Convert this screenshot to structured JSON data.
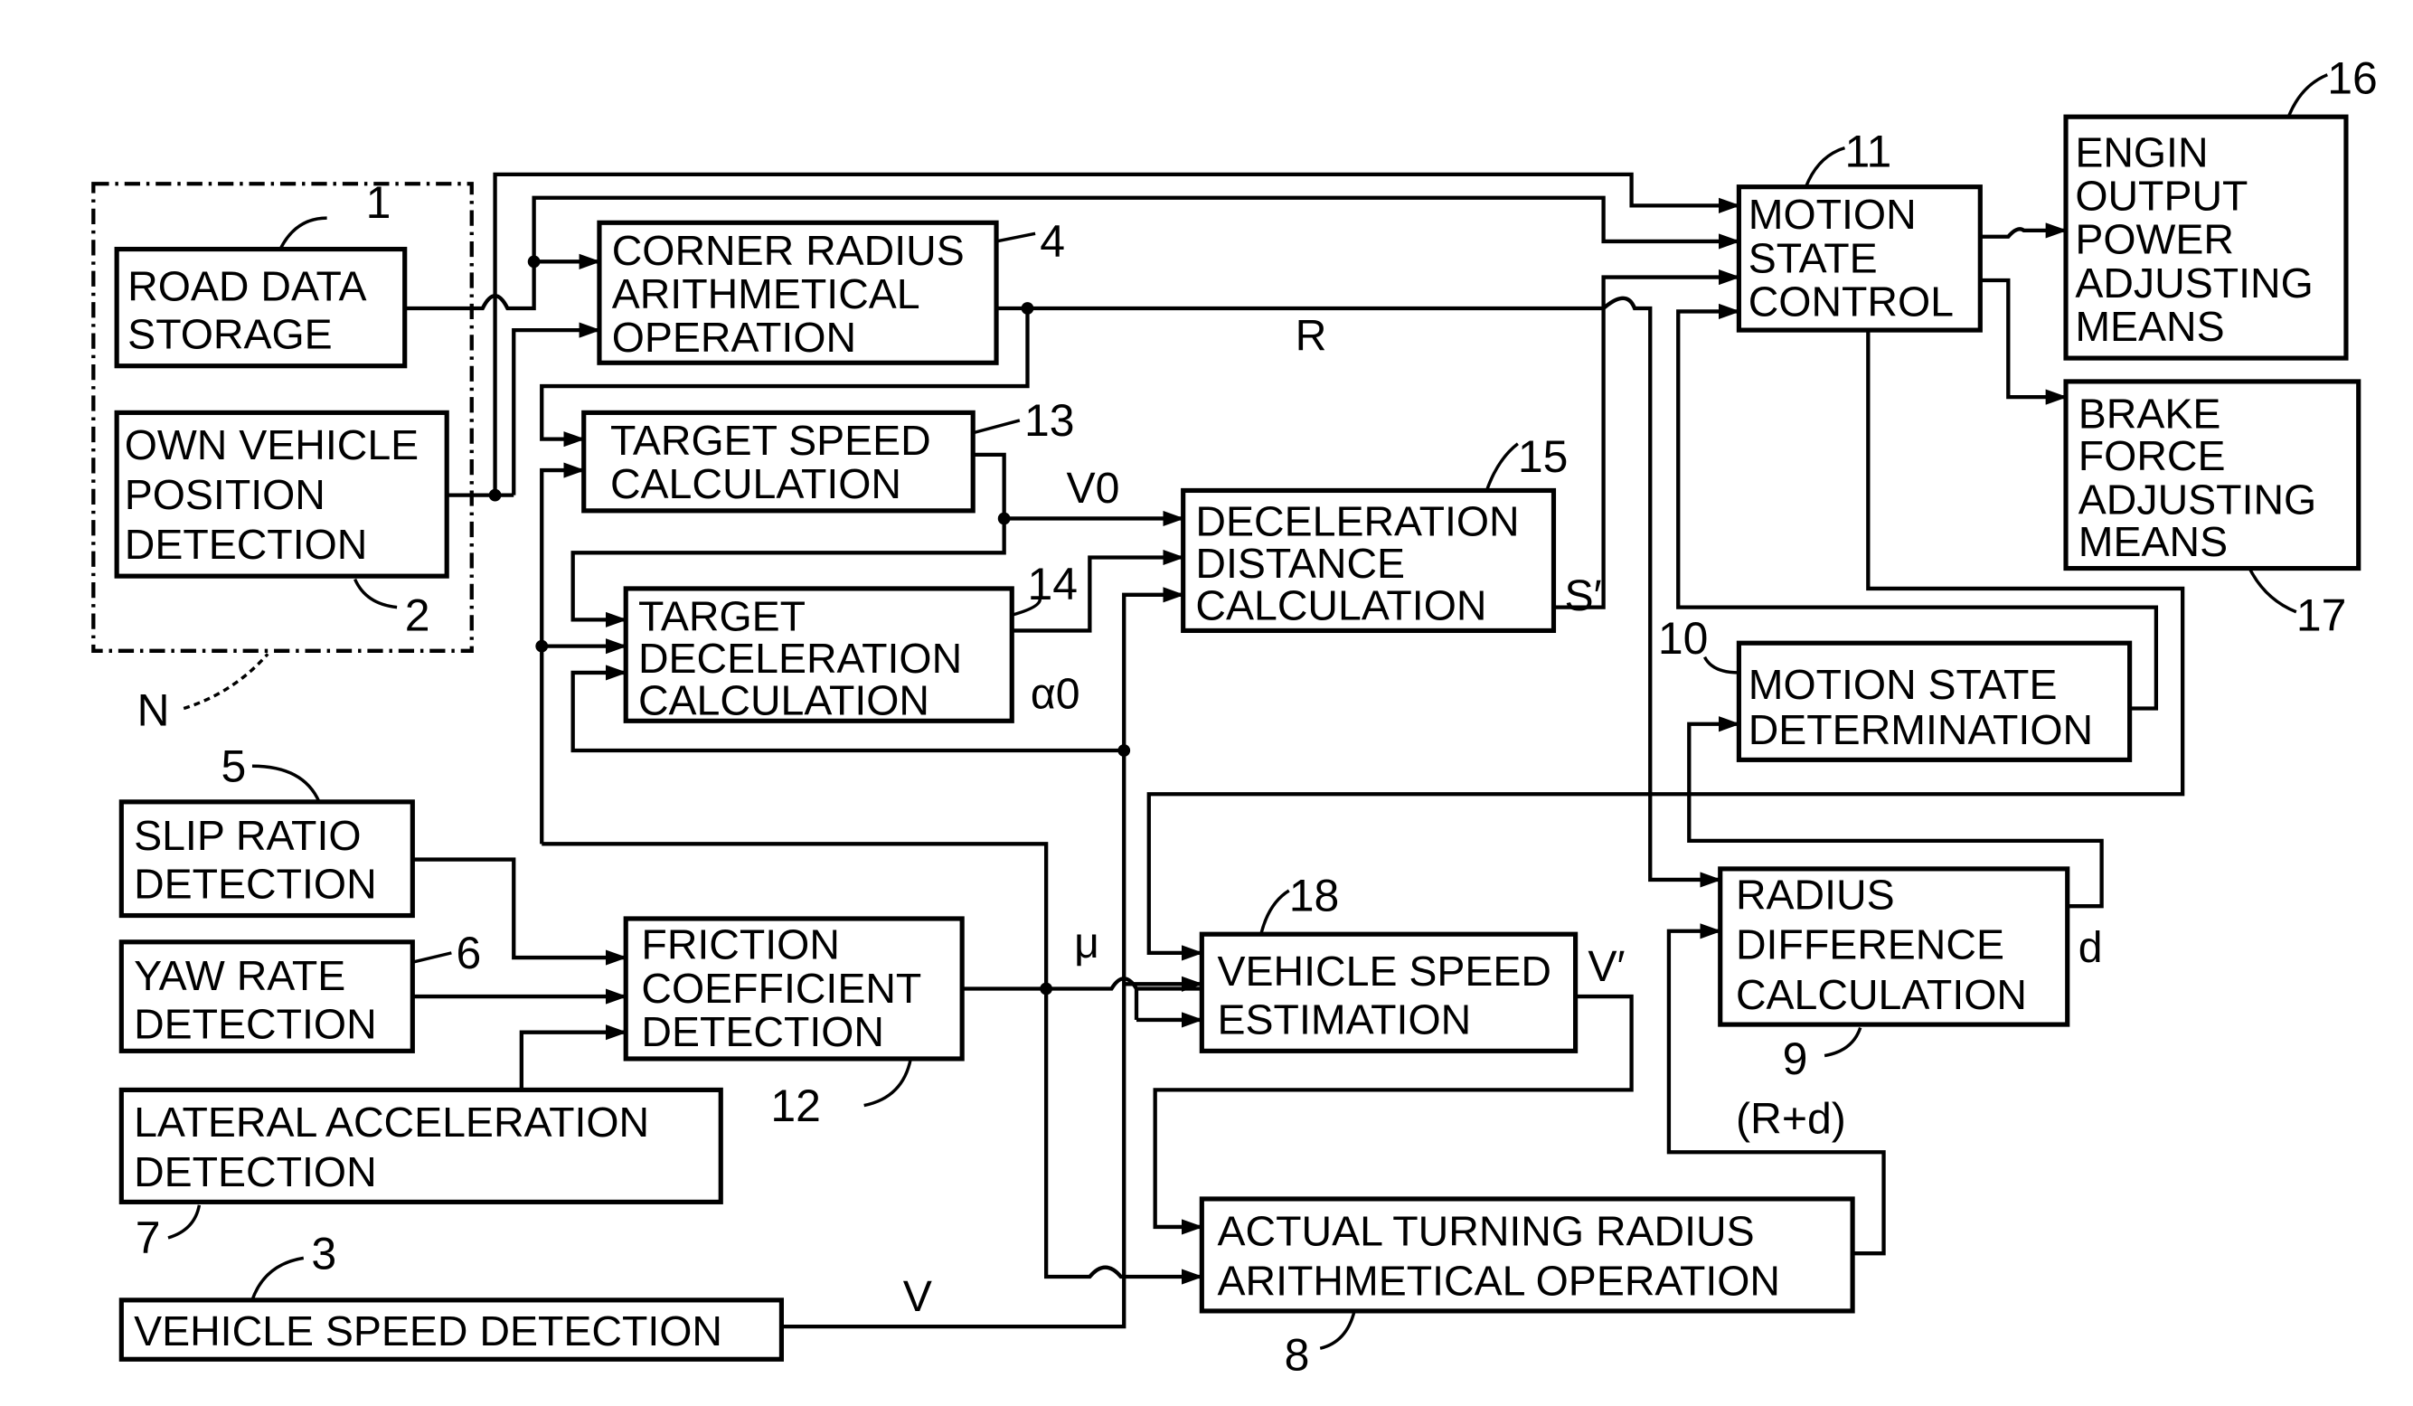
{
  "diagram": {
    "group": {
      "label": "N"
    },
    "blocks": {
      "road_data": {
        "num": "1",
        "lines": [
          "ROAD DATA",
          "STORAGE"
        ]
      },
      "own_vehicle": {
        "num": "2",
        "lines": [
          "OWN VEHICLE",
          "POSITION",
          "DETECTION"
        ]
      },
      "vehicle_speed_det": {
        "num": "3",
        "lines": [
          "VEHICLE SPEED DETECTION"
        ]
      },
      "corner_radius": {
        "num": "4",
        "lines": [
          "CORNER RADIUS",
          "ARITHMETICAL",
          "OPERATION"
        ]
      },
      "slip_ratio": {
        "num": "5",
        "lines": [
          "SLIP RATIO",
          "DETECTION"
        ]
      },
      "yaw_rate": {
        "num": "6",
        "lines": [
          "YAW RATE",
          "DETECTION"
        ]
      },
      "lateral_acc": {
        "num": "7",
        "lines": [
          "LATERAL ACCELERATION",
          "DETECTION"
        ]
      },
      "actual_turning": {
        "num": "8",
        "lines": [
          "ACTUAL TURNING RADIUS",
          "ARITHMETICAL OPERATION"
        ]
      },
      "radius_diff": {
        "num": "9",
        "lines": [
          "RADIUS",
          "DIFFERENCE",
          "CALCULATION"
        ]
      },
      "motion_det": {
        "num": "10",
        "lines": [
          "MOTION STATE",
          "DETERMINATION"
        ]
      },
      "motion_ctrl": {
        "num": "11",
        "lines": [
          "MOTION",
          "STATE",
          "CONTROL"
        ]
      },
      "friction": {
        "num": "12",
        "lines": [
          "FRICTION",
          "COEFFICIENT",
          "DETECTION"
        ]
      },
      "target_speed": {
        "num": "13",
        "lines": [
          "TARGET SPEED",
          "CALCULATION"
        ]
      },
      "target_decel": {
        "num": "14",
        "lines": [
          "TARGET",
          "DECELERATION",
          "CALCULATION"
        ]
      },
      "decel_dist": {
        "num": "15",
        "lines": [
          "DECELERATION",
          "DISTANCE",
          "CALCULATION"
        ]
      },
      "engine": {
        "num": "16",
        "lines": [
          "ENGIN",
          "OUTPUT",
          "POWER",
          "ADJUSTING",
          "MEANS"
        ]
      },
      "brake": {
        "num": "17",
        "lines": [
          "BRAKE",
          "FORCE",
          "ADJUSTING",
          "MEANS"
        ]
      },
      "vehicle_speed_est": {
        "num": "18",
        "lines": [
          "VEHICLE SPEED",
          "ESTIMATION"
        ]
      }
    },
    "signals": {
      "R": "R",
      "V0": "V0",
      "alpha0": "α0",
      "S_prime": "S′",
      "mu": "μ",
      "V_prime": "V′",
      "V": "V",
      "d": "d",
      "R_plus_d": "(R+d)"
    }
  }
}
